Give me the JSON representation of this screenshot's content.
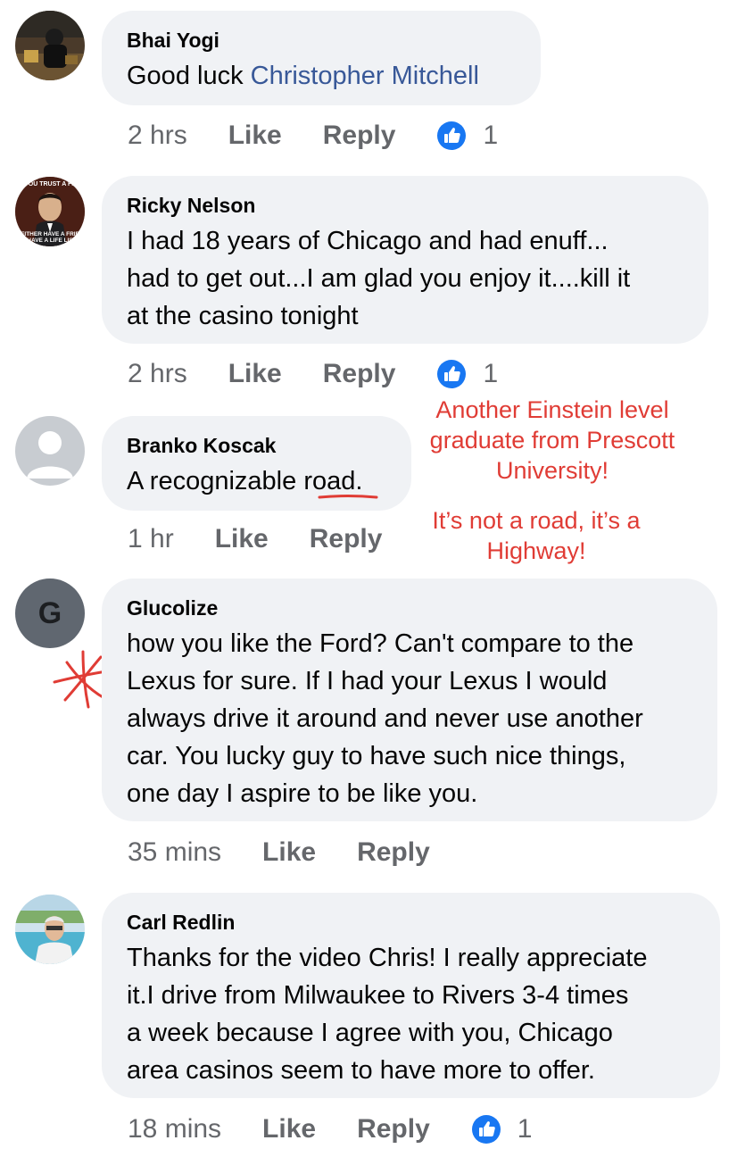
{
  "comments": [
    {
      "author": "Bhai Yogi",
      "text": "Good luck ",
      "mention": "Christopher Mitchell",
      "time": "2 hrs",
      "like_label": "Like",
      "reply_label": "Reply",
      "reaction_count": "1"
    },
    {
      "author": "Ricky Nelson",
      "line1": "I had 18 years of Chicago and had enuff...",
      "line2": "had to get out...I am glad you enjoy it....kill it",
      "line3": "at the casino tonight",
      "avatar_caption_top": "YOU TRUST A FE",
      "avatar_caption_bottom": "NEITHER HAVE A FRIEN",
      "avatar_caption_bottom2": "HAVE A LIFE LIS",
      "time": "2 hrs",
      "like_label": "Like",
      "reply_label": "Reply",
      "reaction_count": "1"
    },
    {
      "author": "Branko Koscak",
      "text_pre": "A recognizable ",
      "text_underlined": "road",
      "text_post": ".",
      "time": "1 hr",
      "like_label": "Like",
      "reply_label": "Reply"
    },
    {
      "author": "Glucolize",
      "avatar_letter": "G",
      "line1": "how you like the Ford?  Can't compare to the",
      "line2": "Lexus for sure.  If I had your Lexus I would",
      "line3": "always drive it around and never use another",
      "line4": "car.  You lucky guy to have such nice things,",
      "line5": "one day I aspire to be like you.",
      "time": "35 mins",
      "like_label": "Like",
      "reply_label": "Reply"
    },
    {
      "author": "Carl Redlin",
      "line1": "Thanks for the video Chris! I really appreciate",
      "line2": "it.I drive from Milwaukee to Rivers 3-4 times",
      "line3": "a week because I agree with you, Chicago",
      "line4": "area casinos seem to have more to offer.",
      "time": "18 mins",
      "like_label": "Like",
      "reply_label": "Reply",
      "reaction_count": "1"
    }
  ],
  "annotations": {
    "note1_line1": "Another Einstein level",
    "note1_line2": "graduate from Prescott",
    "note1_line3": "University!",
    "note2_line1": "It’s not a road, it’s a",
    "note2_line2": "Highway!"
  },
  "colors": {
    "bubble": "#f0f2f5",
    "mention": "#385898",
    "meta": "#65676b",
    "like_icon": "#1877f2",
    "annotation": "#e03c35"
  },
  "icons": {
    "reaction": "like-reaction-icon",
    "annotation_mark": "asterisk-mark-icon"
  }
}
